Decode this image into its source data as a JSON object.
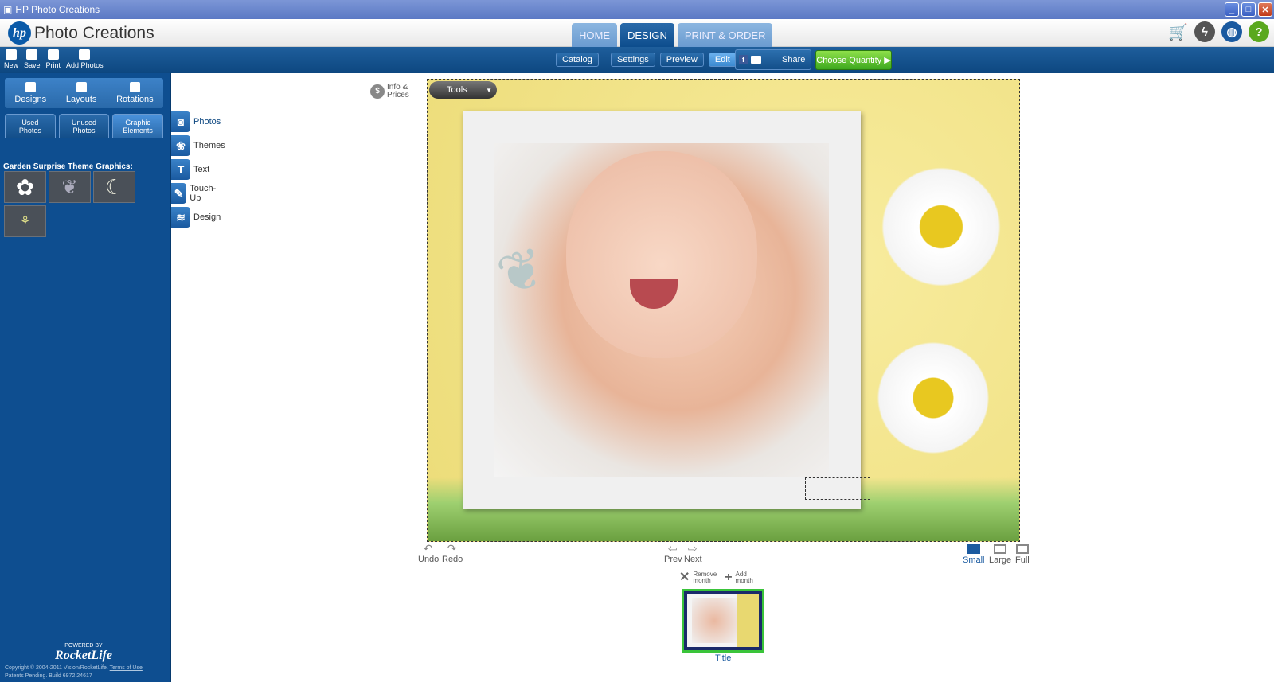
{
  "window": {
    "title": "HP Photo Creations"
  },
  "app": {
    "brand": "hp",
    "name": "Photo Creations"
  },
  "main_tabs": [
    {
      "label": "HOME",
      "active": false
    },
    {
      "label": "DESIGN",
      "active": true
    },
    {
      "label": "PRINT & ORDER",
      "active": false
    }
  ],
  "file_toolbar": [
    {
      "label": "New"
    },
    {
      "label": "Save"
    },
    {
      "label": "Print"
    },
    {
      "label": "Add Photos"
    }
  ],
  "subnav": [
    {
      "label": "Catalog",
      "active": false
    },
    {
      "label": "Settings",
      "active": false
    },
    {
      "label": "Preview",
      "active": false
    },
    {
      "label": "Edit",
      "active": true
    }
  ],
  "share_label": "Share",
  "choose_quantity_label": "Choose Quantity",
  "panel_tabs": [
    {
      "label": "Designs"
    },
    {
      "label": "Layouts"
    },
    {
      "label": "Rotations"
    }
  ],
  "sub_tabs": [
    {
      "label": "Used\nPhotos",
      "active": false
    },
    {
      "label": "Unused\nPhotos",
      "active": false
    },
    {
      "label": "Graphic\nElements",
      "active": true
    }
  ],
  "theme_graphics_title": "Garden Surprise Theme Graphics:",
  "side_tabs": [
    {
      "label": "Photos",
      "icon": "camera-icon",
      "active": true
    },
    {
      "label": "Themes",
      "icon": "themes-icon",
      "active": false
    },
    {
      "label": "Text",
      "icon": "text-icon",
      "active": false
    },
    {
      "label": "Touch-Up",
      "icon": "touch-up-icon",
      "active": false
    },
    {
      "label": "Design",
      "icon": "design-icon",
      "active": false
    }
  ],
  "info_prices": {
    "line1": "Info &",
    "line2": "Prices"
  },
  "tools_label": "Tools",
  "controls": {
    "undo": "Undo",
    "redo": "Redo",
    "prev": "Prev",
    "next": "Next",
    "small": "Small",
    "large": "Large",
    "full": "Full",
    "active_size": "Small"
  },
  "month": {
    "remove": {
      "line1": "Remove",
      "line2": "month"
    },
    "add": {
      "line1": "Add",
      "line2": "month"
    }
  },
  "thumbnail_label": "Title",
  "footer": {
    "powered_by": "POWERED BY",
    "brand": "RocketLife",
    "copyright": "Copyright © 2004-2011 Vision/RocketLife.",
    "terms": "Terms of Use",
    "patents": "Patents Pending. Build 6972.24617"
  },
  "colors": {
    "accent": "#0d4780",
    "active_green": "#3ac43a",
    "sidebar": "#0e4e90"
  }
}
